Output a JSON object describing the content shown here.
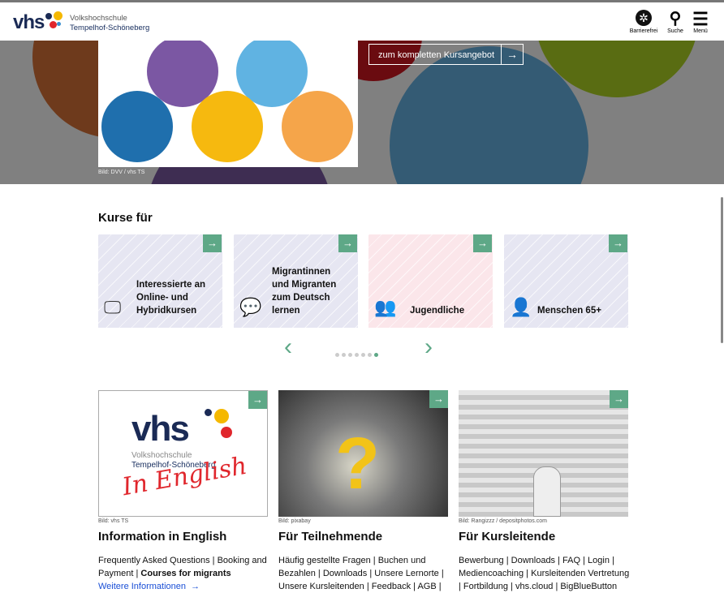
{
  "header": {
    "logo_text": "vhs",
    "org_line1": "Volkshochschule",
    "org_line2": "Tempelhof-Schöneberg",
    "icons": [
      {
        "icon": "accessibility-icon",
        "label": "Barrierefrei"
      },
      {
        "icon": "search-icon",
        "label": "Suche"
      },
      {
        "icon": "menu-icon",
        "label": "Menü"
      }
    ]
  },
  "hero": {
    "image_caption": "Bild: DVV / vhs TS",
    "button_label": "zum kompletten Kursangebot"
  },
  "courses": {
    "heading": "Kurse für",
    "cards": [
      {
        "label": "Interessierte an Online- und Hybridkursen",
        "icon": "monitor-icon"
      },
      {
        "label": "Migrantinnen und Migranten zum Deutsch lernen",
        "icon": "chat-icon"
      },
      {
        "label": "Jugendliche",
        "icon": "group-icon"
      },
      {
        "label": "Menschen 65+",
        "icon": "person-icon"
      }
    ],
    "dots_total": 7,
    "dots_active": 7
  },
  "teasers": [
    {
      "caption": "Bild: vhs TS",
      "title": "Information in English",
      "logo_text": "vhs",
      "logo_line1": "Volkshochschule",
      "logo_line2": "Tempelhof-Schöneberg",
      "handwriting": "In English",
      "links": [
        "Frequently Asked Questions",
        "Booking and Payment",
        "Courses for migrants"
      ],
      "more": "Weitere Informationen"
    },
    {
      "caption": "Bild: pixabay",
      "title": "Für Teilnehmende",
      "links": [
        "Häufig gestellte Fragen",
        "Buchen und Bezahlen",
        "Downloads",
        "Unsere Lernorte",
        "Unsere Kursleitenden",
        "Feedback",
        "AGB"
      ]
    },
    {
      "caption": "Bild: Rangizzz / depositphotos.com",
      "title": "Für Kursleitende",
      "links": [
        "Bewerbung",
        "Downloads",
        "FAQ",
        "Login",
        "Mediencoaching",
        "Kursleitenden Vertretung",
        "Fortbildung",
        "vhs.cloud",
        "BigBlueButton"
      ]
    }
  ]
}
